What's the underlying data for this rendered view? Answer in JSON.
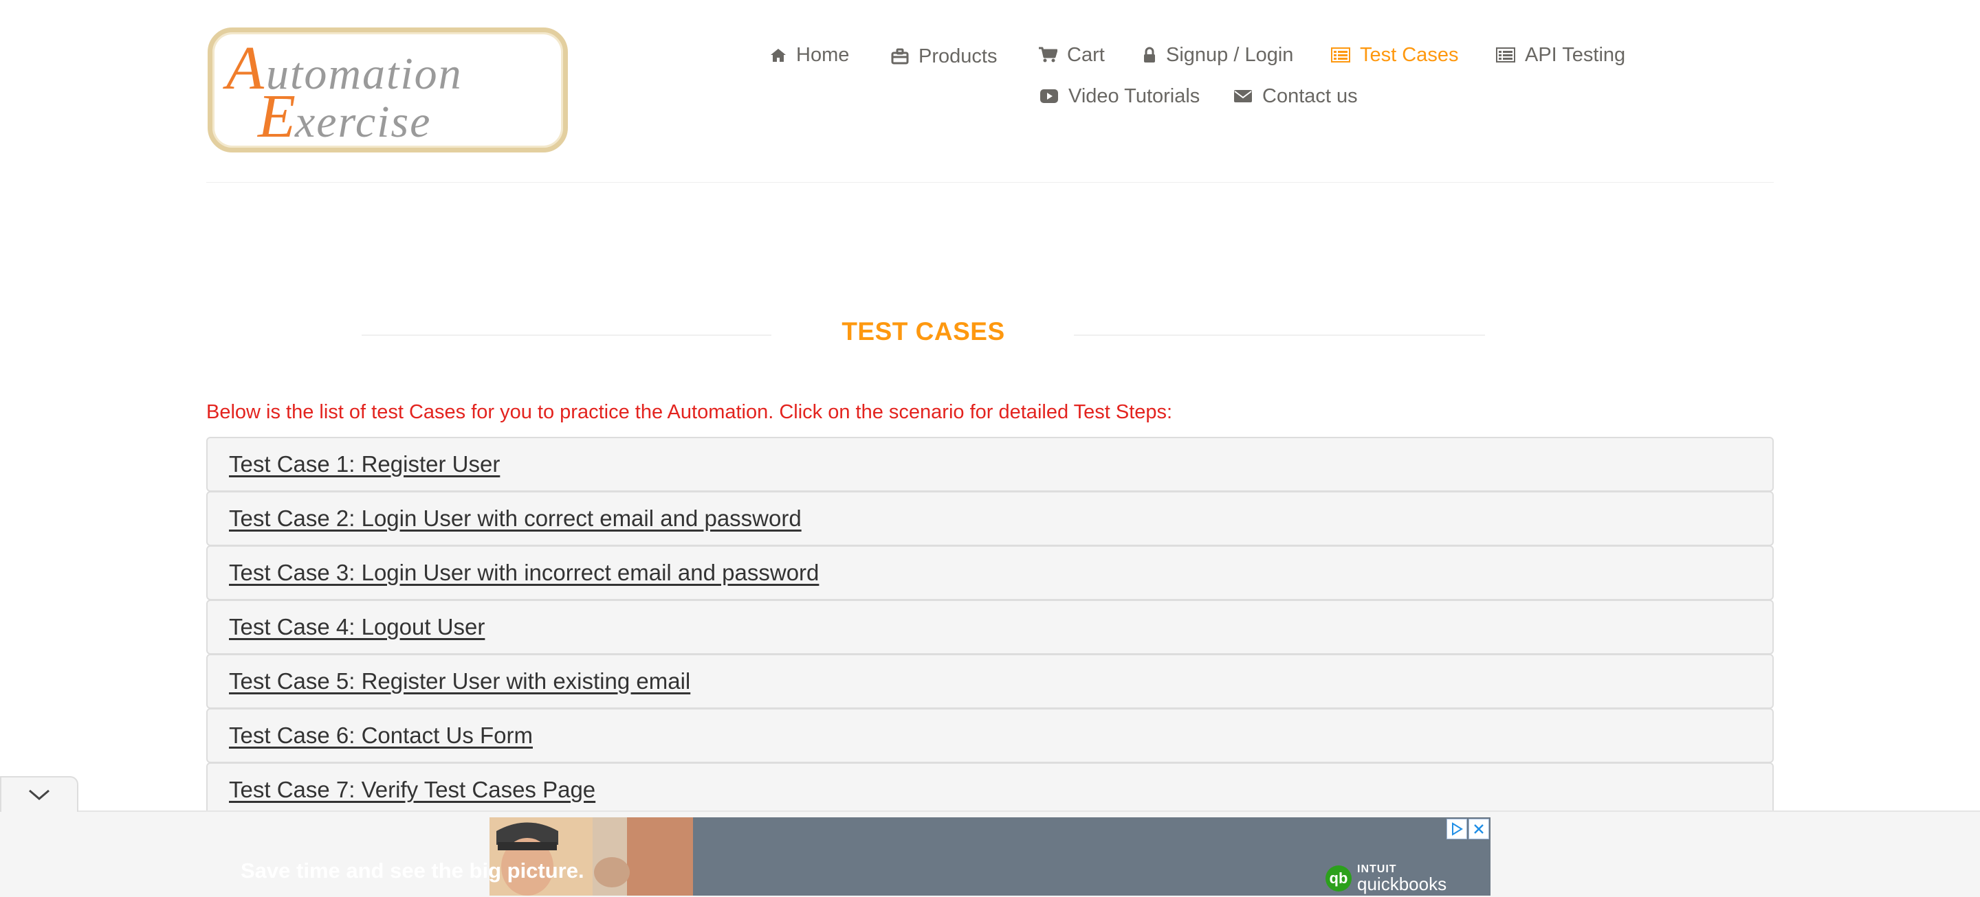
{
  "logo": {
    "line1": "Automation",
    "line2": "Exercise"
  },
  "nav": {
    "items": [
      {
        "label": "Home",
        "icon": "home-icon"
      },
      {
        "label": "Products",
        "icon": "briefcase-icon"
      },
      {
        "label": "Cart",
        "icon": "cart-icon"
      },
      {
        "label": "Signup / Login",
        "icon": "lock-icon"
      },
      {
        "label": "Test Cases",
        "icon": "list-icon",
        "active": true
      },
      {
        "label": "API Testing",
        "icon": "list-icon"
      },
      {
        "label": "Video Tutorials",
        "icon": "youtube-play-icon"
      },
      {
        "label": "Contact us",
        "icon": "envelope-icon"
      }
    ]
  },
  "page": {
    "title": "TEST CASES",
    "intro": "Below is the list of test Cases for you to practice the Automation. Click on the scenario for detailed Test Steps:"
  },
  "test_cases": [
    "Test Case 1: Register User",
    "Test Case 2: Login User with correct email and password",
    "Test Case 3: Login User with incorrect email and password",
    "Test Case 4: Logout User",
    "Test Case 5: Register User with existing email",
    "Test Case 6: Contact Us Form",
    "Test Case 7: Verify Test Cases Page"
  ],
  "ad": {
    "headline": "Save time and see the big picture.",
    "brand_small": "INTUIT",
    "brand_big": "quickbooks",
    "brand_mark": "qb"
  },
  "colors": {
    "accent": "#FE980F",
    "intro_text": "#e3231e",
    "nav_text": "#696763",
    "row_bg": "#f5f5f5"
  }
}
